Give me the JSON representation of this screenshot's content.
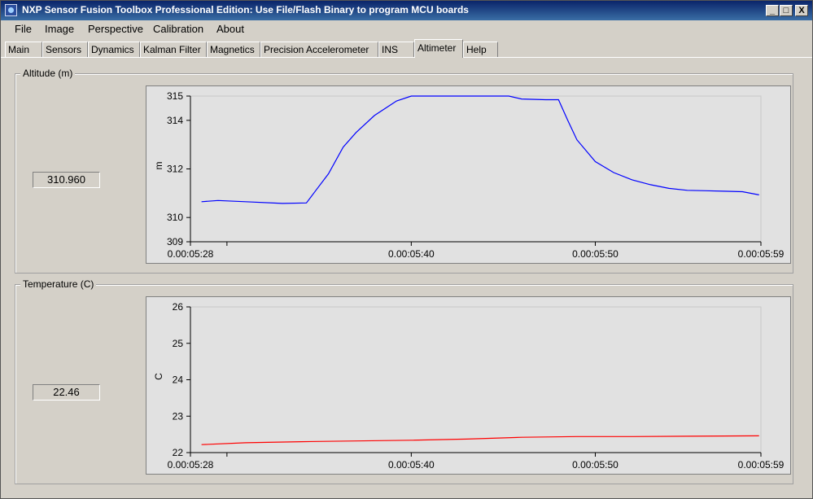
{
  "window": {
    "title": "NXP Sensor Fusion Toolbox Professional Edition: Use File/Flash Binary to program MCU boards",
    "controls": {
      "minimize": "_",
      "maximize": "□",
      "close": "X"
    }
  },
  "menu": [
    "File",
    "Image",
    "Perspective",
    "Calibration",
    "About"
  ],
  "tabs": [
    "Main",
    "Sensors",
    "Dynamics",
    "Kalman Filter",
    "Magnetics",
    "Precision Accelerometer",
    "INS",
    "Altimeter",
    "Help"
  ],
  "active_tab": "Altimeter",
  "altitude": {
    "group_label": "Altitude (m)",
    "value": "310.960"
  },
  "temperature": {
    "group_label": "Temperature (C)",
    "value": "22.46"
  },
  "colors": {
    "altitude_line": "#0000ff",
    "temperature_line": "#ff0000"
  },
  "chart_data": [
    {
      "type": "line",
      "title": "",
      "ylabel": "m",
      "xlabel": "",
      "ylim": [
        309,
        315
      ],
      "yticks": [
        "309",
        "310",
        "312",
        "314",
        "315"
      ],
      "xlim": [
        28,
        59
      ],
      "xticks": [
        {
          "t": 28,
          "label": "0.00:05:28"
        },
        {
          "t": 40,
          "label": "0.00:05:40"
        },
        {
          "t": 50,
          "label": "0.00:05:50"
        },
        {
          "t": 59,
          "label": "0.00:05:59"
        }
      ],
      "series": [
        {
          "x": [
            28.6,
            29.5,
            31,
            33,
            34.3,
            34.8,
            35.5,
            36.3,
            37,
            38,
            39.2,
            40,
            42,
            44,
            45.3,
            46,
            47.3,
            48,
            48.5,
            49,
            50,
            51,
            52,
            53,
            54,
            55,
            56,
            57,
            58,
            58.9
          ],
          "y": [
            310.65,
            310.7,
            310.65,
            310.58,
            310.6,
            311.1,
            311.8,
            312.9,
            313.5,
            314.2,
            314.8,
            315.0,
            315.0,
            315.0,
            315.0,
            314.88,
            314.85,
            314.85,
            314.0,
            313.2,
            312.3,
            311.85,
            311.55,
            311.35,
            311.2,
            311.12,
            311.1,
            311.08,
            311.06,
            310.93
          ]
        }
      ]
    },
    {
      "type": "line",
      "title": "",
      "ylabel": "C",
      "xlabel": "",
      "ylim": [
        22,
        26
      ],
      "yticks": [
        "22",
        "23",
        "24",
        "25",
        "26"
      ],
      "xlim": [
        28,
        59
      ],
      "xticks": [
        {
          "t": 28,
          "label": "0.00:05:28"
        },
        {
          "t": 40,
          "label": "0.00:05:40"
        },
        {
          "t": 50,
          "label": "0.00:05:50"
        },
        {
          "t": 59,
          "label": "0.00:05:59"
        }
      ],
      "series": [
        {
          "x": [
            28.6,
            31,
            34,
            37,
            40,
            43,
            46,
            49,
            52,
            55,
            58.9
          ],
          "y": [
            22.22,
            22.27,
            22.3,
            22.32,
            22.34,
            22.37,
            22.42,
            22.44,
            22.44,
            22.45,
            22.46
          ]
        }
      ]
    }
  ]
}
